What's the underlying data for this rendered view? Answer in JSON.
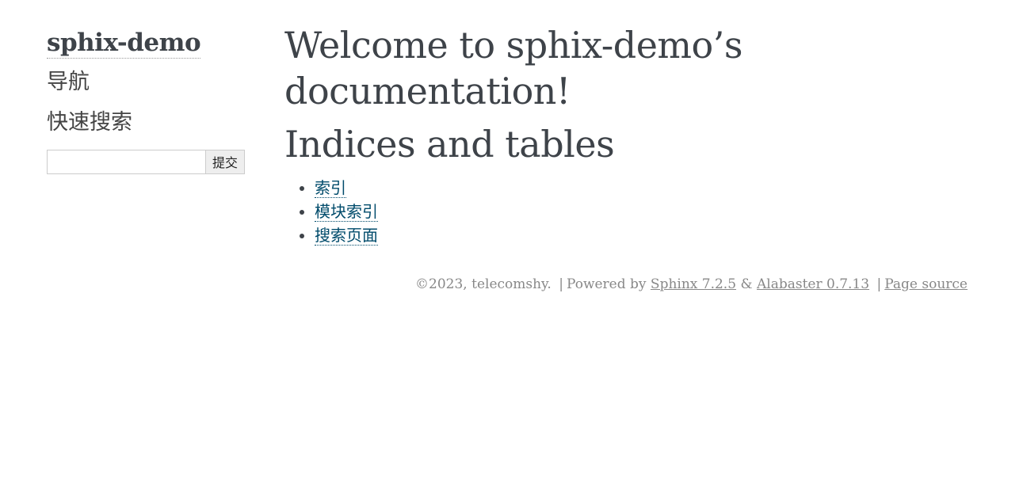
{
  "sidebar": {
    "logo": "sphix-demo",
    "nav_heading": "导航",
    "quick_search_heading": "快速搜索",
    "search_value": "",
    "search_submit": "提交"
  },
  "main": {
    "title": "Welcome to sphix-demo’s documentation!",
    "section_title": "Indices and tables",
    "links": [
      {
        "label": "索引"
      },
      {
        "label": "模块索引"
      },
      {
        "label": "搜索页面"
      }
    ]
  },
  "footer": {
    "copyright": "©2023, telecomshy.",
    "sep1": "|",
    "powered_by": "Powered by",
    "sphinx_link": "Sphinx 7.2.5",
    "amp": "&",
    "alabaster_link": "Alabaster 0.7.13",
    "sep2": "|",
    "page_source_link": "Page source"
  },
  "colors": {
    "text": "#3e4349",
    "link": "#004b6b",
    "footer_text": "#888888"
  }
}
